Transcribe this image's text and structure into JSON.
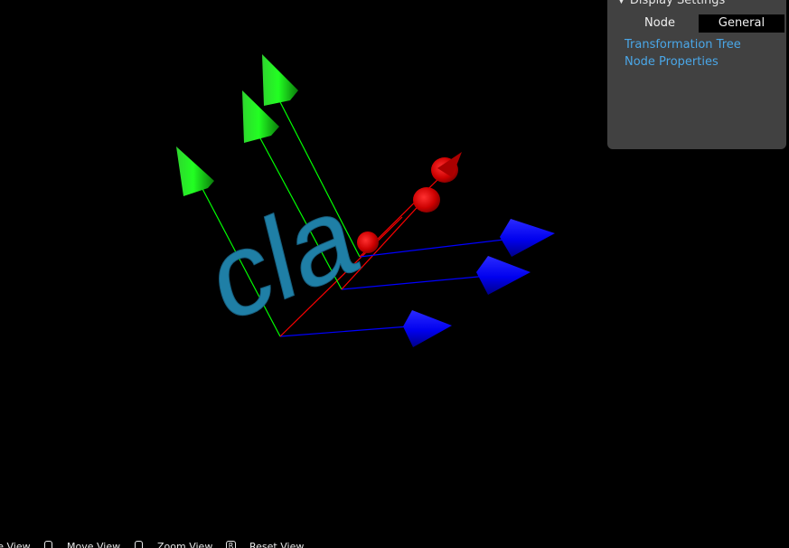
{
  "panel": {
    "header": "Display Settings",
    "tabs": {
      "node": "Node",
      "general": "General"
    },
    "links": {
      "transformation_tree": "Transformation Tree",
      "node_properties": "Node Properties"
    }
  },
  "scene": {
    "label_text": "cla",
    "colors": {
      "x_axis": "#0000ff",
      "y_axis": "#00ff00",
      "z_axis": "#ff0000",
      "label": "#1f7fa6",
      "panel_link": "#4aa7e8"
    }
  },
  "hints": {
    "rotate_view": "Rotate View",
    "move_view": "Move View",
    "zoom_view": "Zoom View",
    "reset_view": "Reset View",
    "reset_key": "R"
  }
}
